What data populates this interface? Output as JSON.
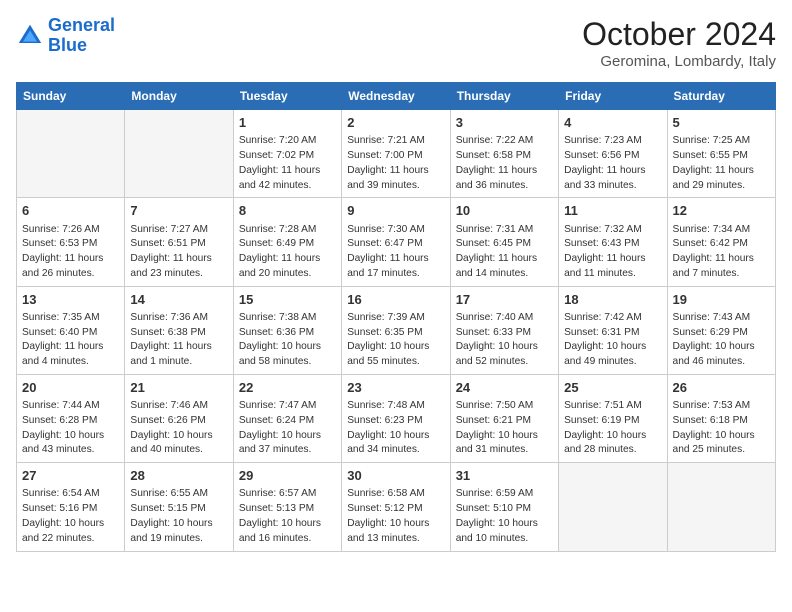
{
  "logo": {
    "line1": "General",
    "line2": "Blue"
  },
  "title": "October 2024",
  "location": "Geromina, Lombardy, Italy",
  "days_header": [
    "Sunday",
    "Monday",
    "Tuesday",
    "Wednesday",
    "Thursday",
    "Friday",
    "Saturday"
  ],
  "weeks": [
    [
      {
        "day": "",
        "content": ""
      },
      {
        "day": "",
        "content": ""
      },
      {
        "day": "1",
        "content": "Sunrise: 7:20 AM\nSunset: 7:02 PM\nDaylight: 11 hours and 42 minutes."
      },
      {
        "day": "2",
        "content": "Sunrise: 7:21 AM\nSunset: 7:00 PM\nDaylight: 11 hours and 39 minutes."
      },
      {
        "day": "3",
        "content": "Sunrise: 7:22 AM\nSunset: 6:58 PM\nDaylight: 11 hours and 36 minutes."
      },
      {
        "day": "4",
        "content": "Sunrise: 7:23 AM\nSunset: 6:56 PM\nDaylight: 11 hours and 33 minutes."
      },
      {
        "day": "5",
        "content": "Sunrise: 7:25 AM\nSunset: 6:55 PM\nDaylight: 11 hours and 29 minutes."
      }
    ],
    [
      {
        "day": "6",
        "content": "Sunrise: 7:26 AM\nSunset: 6:53 PM\nDaylight: 11 hours and 26 minutes."
      },
      {
        "day": "7",
        "content": "Sunrise: 7:27 AM\nSunset: 6:51 PM\nDaylight: 11 hours and 23 minutes."
      },
      {
        "day": "8",
        "content": "Sunrise: 7:28 AM\nSunset: 6:49 PM\nDaylight: 11 hours and 20 minutes."
      },
      {
        "day": "9",
        "content": "Sunrise: 7:30 AM\nSunset: 6:47 PM\nDaylight: 11 hours and 17 minutes."
      },
      {
        "day": "10",
        "content": "Sunrise: 7:31 AM\nSunset: 6:45 PM\nDaylight: 11 hours and 14 minutes."
      },
      {
        "day": "11",
        "content": "Sunrise: 7:32 AM\nSunset: 6:43 PM\nDaylight: 11 hours and 11 minutes."
      },
      {
        "day": "12",
        "content": "Sunrise: 7:34 AM\nSunset: 6:42 PM\nDaylight: 11 hours and 7 minutes."
      }
    ],
    [
      {
        "day": "13",
        "content": "Sunrise: 7:35 AM\nSunset: 6:40 PM\nDaylight: 11 hours and 4 minutes."
      },
      {
        "day": "14",
        "content": "Sunrise: 7:36 AM\nSunset: 6:38 PM\nDaylight: 11 hours and 1 minute."
      },
      {
        "day": "15",
        "content": "Sunrise: 7:38 AM\nSunset: 6:36 PM\nDaylight: 10 hours and 58 minutes."
      },
      {
        "day": "16",
        "content": "Sunrise: 7:39 AM\nSunset: 6:35 PM\nDaylight: 10 hours and 55 minutes."
      },
      {
        "day": "17",
        "content": "Sunrise: 7:40 AM\nSunset: 6:33 PM\nDaylight: 10 hours and 52 minutes."
      },
      {
        "day": "18",
        "content": "Sunrise: 7:42 AM\nSunset: 6:31 PM\nDaylight: 10 hours and 49 minutes."
      },
      {
        "day": "19",
        "content": "Sunrise: 7:43 AM\nSunset: 6:29 PM\nDaylight: 10 hours and 46 minutes."
      }
    ],
    [
      {
        "day": "20",
        "content": "Sunrise: 7:44 AM\nSunset: 6:28 PM\nDaylight: 10 hours and 43 minutes."
      },
      {
        "day": "21",
        "content": "Sunrise: 7:46 AM\nSunset: 6:26 PM\nDaylight: 10 hours and 40 minutes."
      },
      {
        "day": "22",
        "content": "Sunrise: 7:47 AM\nSunset: 6:24 PM\nDaylight: 10 hours and 37 minutes."
      },
      {
        "day": "23",
        "content": "Sunrise: 7:48 AM\nSunset: 6:23 PM\nDaylight: 10 hours and 34 minutes."
      },
      {
        "day": "24",
        "content": "Sunrise: 7:50 AM\nSunset: 6:21 PM\nDaylight: 10 hours and 31 minutes."
      },
      {
        "day": "25",
        "content": "Sunrise: 7:51 AM\nSunset: 6:19 PM\nDaylight: 10 hours and 28 minutes."
      },
      {
        "day": "26",
        "content": "Sunrise: 7:53 AM\nSunset: 6:18 PM\nDaylight: 10 hours and 25 minutes."
      }
    ],
    [
      {
        "day": "27",
        "content": "Sunrise: 6:54 AM\nSunset: 5:16 PM\nDaylight: 10 hours and 22 minutes."
      },
      {
        "day": "28",
        "content": "Sunrise: 6:55 AM\nSunset: 5:15 PM\nDaylight: 10 hours and 19 minutes."
      },
      {
        "day": "29",
        "content": "Sunrise: 6:57 AM\nSunset: 5:13 PM\nDaylight: 10 hours and 16 minutes."
      },
      {
        "day": "30",
        "content": "Sunrise: 6:58 AM\nSunset: 5:12 PM\nDaylight: 10 hours and 13 minutes."
      },
      {
        "day": "31",
        "content": "Sunrise: 6:59 AM\nSunset: 5:10 PM\nDaylight: 10 hours and 10 minutes."
      },
      {
        "day": "",
        "content": ""
      },
      {
        "day": "",
        "content": ""
      }
    ]
  ]
}
